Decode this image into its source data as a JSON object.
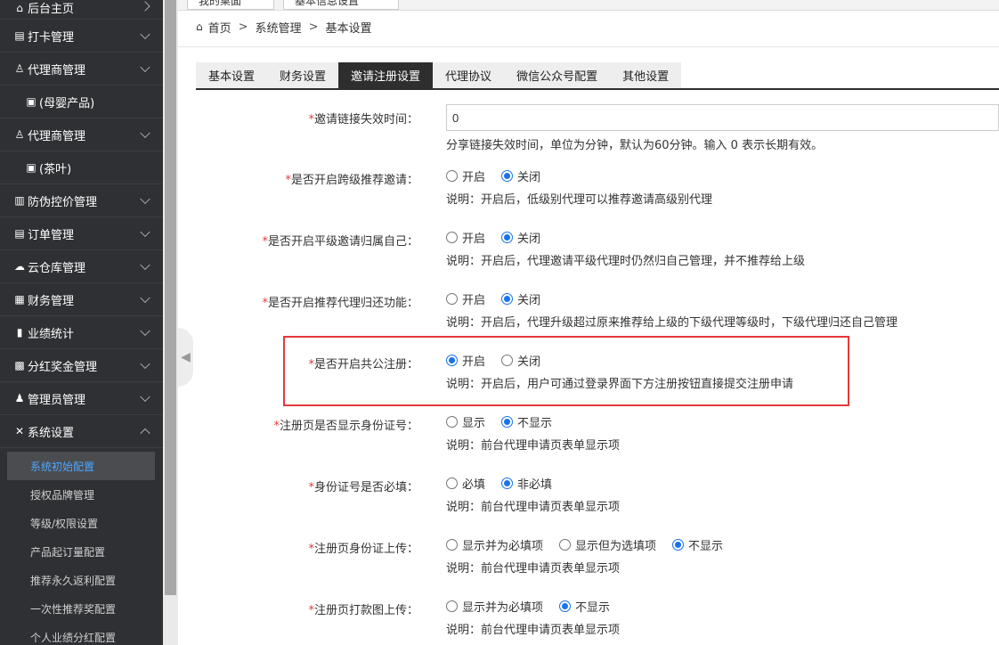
{
  "sidebar": {
    "items": [
      {
        "label": "后台主页",
        "icon": "home-icon",
        "glyph": "⌂"
      },
      {
        "label": "打卡管理",
        "icon": "clipboard-icon",
        "glyph": "▤"
      },
      {
        "label": "代理商管理",
        "icon": "user-icon",
        "glyph": "♙"
      },
      {
        "label": "(母婴产品)",
        "icon": "folder-icon",
        "glyph": "▣"
      },
      {
        "label": "代理商管理",
        "icon": "user-icon",
        "glyph": "♙"
      },
      {
        "label": "(茶叶)",
        "icon": "folder-icon",
        "glyph": "▣"
      },
      {
        "label": "防伪控价管理",
        "icon": "barcode-icon",
        "glyph": "▥"
      },
      {
        "label": "订单管理",
        "icon": "clipboard-icon",
        "glyph": "▤"
      },
      {
        "label": "云仓库管理",
        "icon": "cloud-icon",
        "glyph": "☁"
      },
      {
        "label": "财务管理",
        "icon": "book-icon",
        "glyph": "▦"
      },
      {
        "label": "业绩统计",
        "icon": "chart-icon",
        "glyph": "▮"
      },
      {
        "label": "分红奖金管理",
        "icon": "database-icon",
        "glyph": "▩"
      },
      {
        "label": "管理员管理",
        "icon": "user-group-icon",
        "glyph": "♟"
      },
      {
        "label": "系统设置",
        "icon": "wrench-icon",
        "glyph": "✕"
      }
    ],
    "submenu": [
      {
        "label": "系统初始配置"
      },
      {
        "label": "授权品牌管理"
      },
      {
        "label": "等级/权限设置"
      },
      {
        "label": "产品起订量配置"
      },
      {
        "label": "推荐永久返利配置"
      },
      {
        "label": "一次性推荐奖配置"
      },
      {
        "label": "个人业绩分红配置"
      }
    ]
  },
  "top_tabs": [
    {
      "label": "我的桌面"
    },
    {
      "label": "基本信息设置"
    }
  ],
  "breadcrumb": {
    "home": "首页",
    "sep": ">",
    "level1": "系统管理",
    "level2": "基本设置"
  },
  "settings_tabs": [
    {
      "label": "基本设置"
    },
    {
      "label": "财务设置"
    },
    {
      "label": "邀请注册设置"
    },
    {
      "label": "代理协议"
    },
    {
      "label": "微信公众号配置"
    },
    {
      "label": "其他设置"
    }
  ],
  "form": {
    "invite_expire": {
      "required_mark": "*",
      "label": "邀请链接失效时间：",
      "value": "0",
      "help": "分享链接失效时间，单位为分钟，默认为60分钟。输入 0 表示长期有效。"
    },
    "cross_level": {
      "required_mark": "*",
      "label": "是否开启跨级推荐邀请：",
      "options": [
        "开启",
        "关闭"
      ],
      "selected": 1,
      "help": "说明：开启后，低级别代理可以推荐邀请高级别代理"
    },
    "same_level": {
      "required_mark": "*",
      "label": "是否开启平级邀请归属自己：",
      "options": [
        "开启",
        "关闭"
      ],
      "selected": 1,
      "help": "说明：开启后，代理邀请平级代理时仍然归自己管理，并不推荐给上级"
    },
    "return_agent": {
      "required_mark": "*",
      "label": "是否开启推荐代理归还功能：",
      "options": [
        "开启",
        "关闭"
      ],
      "selected": 1,
      "help": "说明：开启后，代理升级超过原来推荐给上级的下级代理等级时，下级代理归还自己管理"
    },
    "public_register": {
      "required_mark": "*",
      "label": "是否开启共公注册：",
      "options": [
        "开启",
        "关闭"
      ],
      "selected": 0,
      "help": "说明：开启后，用户可通过登录界面下方注册按钮直接提交注册申请"
    },
    "show_id": {
      "required_mark": "*",
      "label": "注册页是否显示身份证号：",
      "options": [
        "显示",
        "不显示"
      ],
      "selected": 1,
      "help": "说明：前台代理申请页表单显示项"
    },
    "id_required": {
      "required_mark": "*",
      "label": "身份证号是否必填：",
      "options": [
        "必填",
        "非必填"
      ],
      "selected": 1,
      "help": "说明：前台代理申请页表单显示项"
    },
    "id_upload": {
      "required_mark": "*",
      "label": "注册页身份证上传：",
      "options": [
        "显示并为必填项",
        "显示但为选填项",
        "不显示"
      ],
      "selected": 2,
      "help": "说明：前台代理申请页表单显示项"
    },
    "payment_upload": {
      "required_mark": "*",
      "label": "注册页打款图上传：",
      "options": [
        "显示并为必填项",
        "不显示"
      ],
      "selected": 1,
      "help": "说明：前台代理申请页表单显示项"
    }
  },
  "colors": {
    "accent": "#1a73e8",
    "required": "#e4393c",
    "sidebar_bg": "#2f3033",
    "active_tab": "#2e2e2e",
    "highlight": "#e4393c"
  }
}
